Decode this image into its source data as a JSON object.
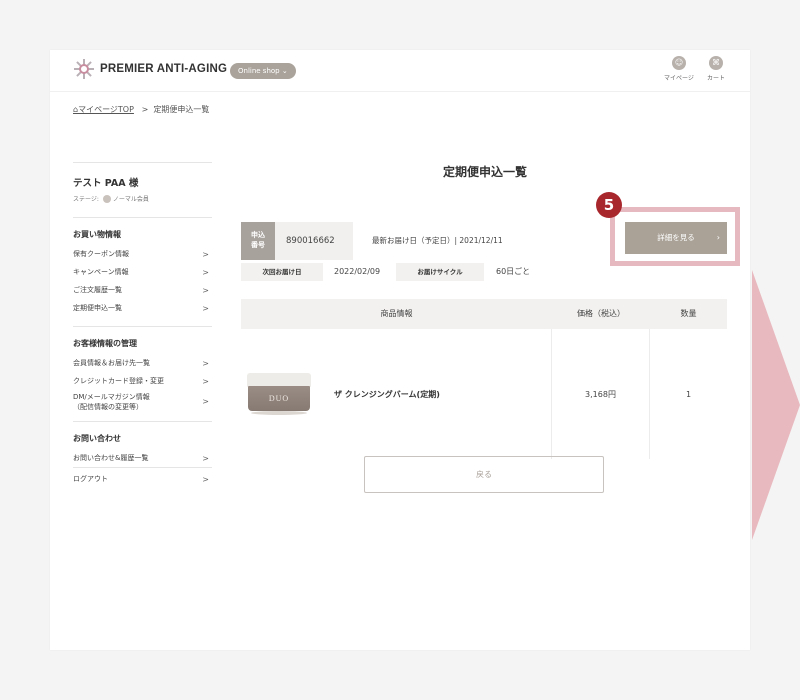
{
  "header": {
    "brand": "PREMIER ANTI-AGING",
    "shop_pill": "Online shop  ⌄",
    "mypage_label": "マイページ",
    "cart_label": "カート",
    "mypage_icon": "person-icon",
    "cart_icon": "cart-icon"
  },
  "breadcrumb": {
    "home": "⌂マイページTOP",
    "sep": ">",
    "current": "定期便申込一覧"
  },
  "sidebar": {
    "user_name": "テスト PAA 様",
    "stage_label": "ステージ:",
    "stage_value": "ノーマル会員",
    "sections": [
      {
        "title": "お買い物情報",
        "items": [
          "保有クーポン情報",
          "キャンペーン情報",
          "ご注文履歴一覧",
          "定期便申込一覧"
        ]
      },
      {
        "title": "お客様情報の管理",
        "items": [
          "会員情報＆お届け先一覧",
          "クレジットカード登録・変更",
          "DM/メールマガジン情報（配信情報の変更等）"
        ]
      },
      {
        "title": "お問い合わせ",
        "items": [
          "お問い合わせ&履歴一覧"
        ]
      }
    ],
    "dm_line1": "DM/メールマガジン情報",
    "dm_line2": "（配信情報の変更等）",
    "logout": "ログアウト",
    "chevron": ">"
  },
  "main": {
    "title": "定期便申込一覧",
    "order": {
      "label_line1": "申込",
      "label_line2": "番号",
      "number": "890016662",
      "latest_delivery": "最新お届け日（予定日）| 2021/12/11",
      "next_label": "次回お届け日",
      "next_value": "2022/02/09",
      "cycle_label": "お届けサイクル",
      "cycle_value": "60日ごと"
    },
    "detail_button": "詳細を見る",
    "step_badge": "5",
    "table": {
      "headers": [
        "商品情報",
        "価格（税込）",
        "数量"
      ],
      "rows": [
        {
          "brand_on_jar": "DUO",
          "name": "ザ クレンジングバーム(定期)",
          "price": "3,168円",
          "qty": "1"
        }
      ]
    },
    "back_button": "戻る"
  },
  "colors": {
    "accent_button": "#aaa297",
    "highlight_border": "#e6b8bf",
    "badge": "#a8272d",
    "arrow": "#e8b9bf"
  }
}
